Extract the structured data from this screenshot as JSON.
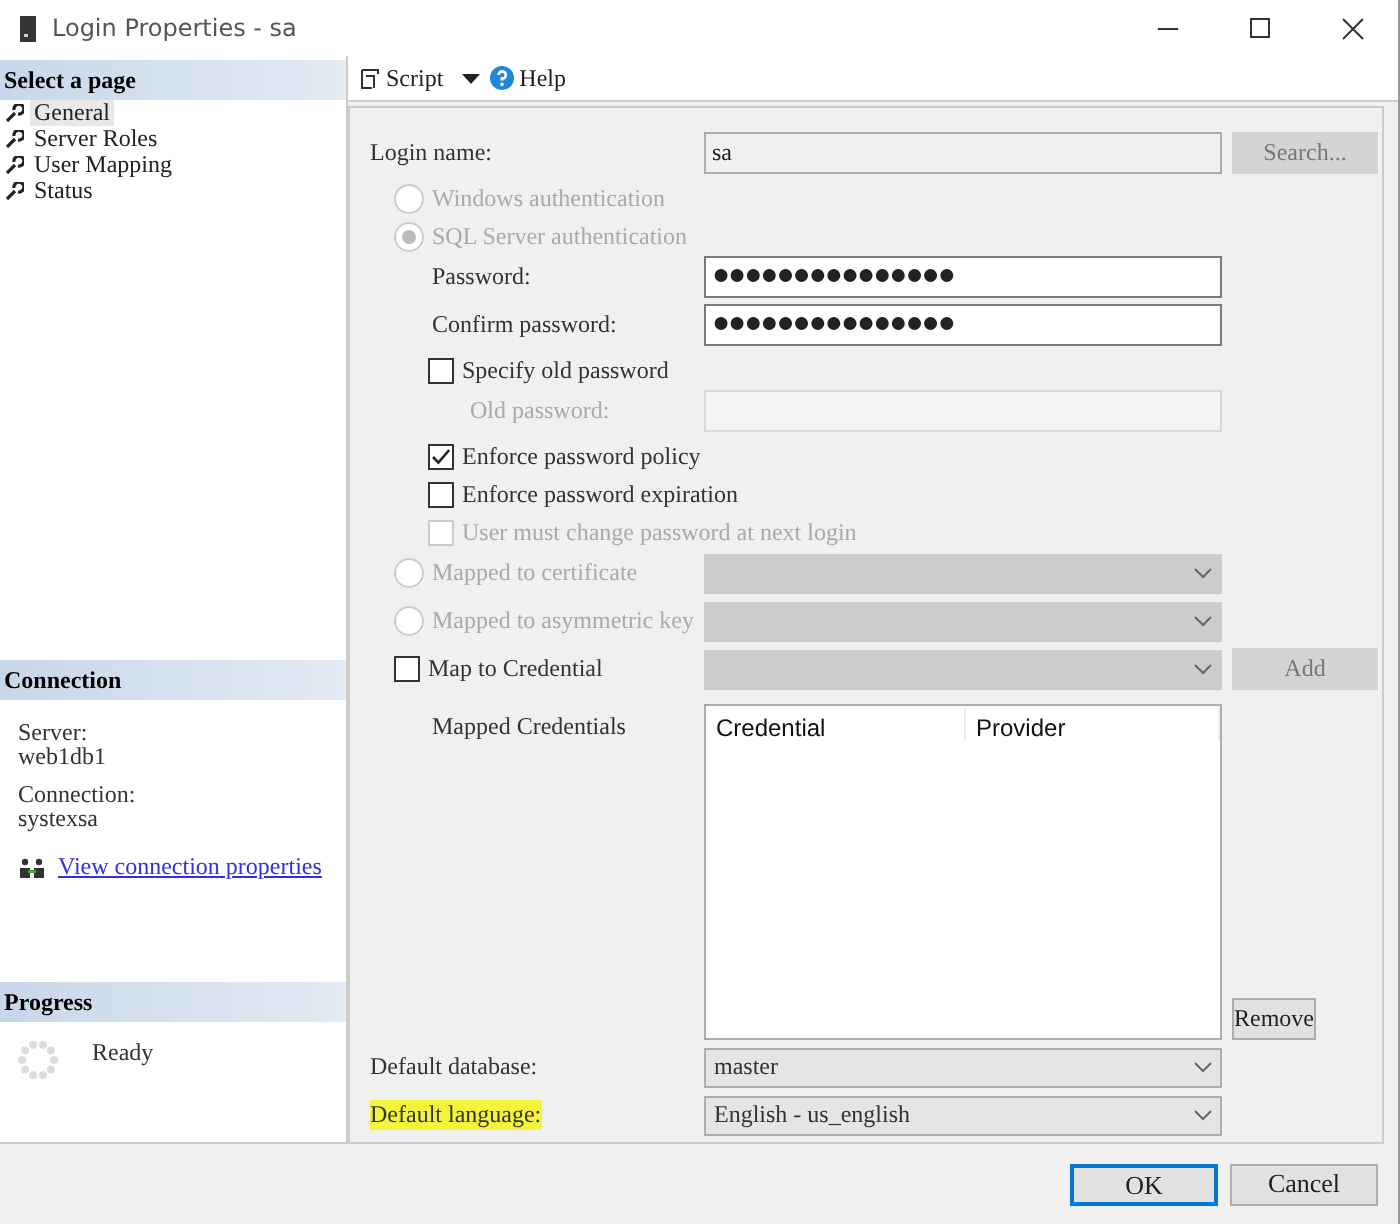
{
  "window": {
    "title": "Login Properties - sa"
  },
  "sidebar": {
    "header": "Select a page",
    "pages": [
      {
        "label": "General",
        "selected": true
      },
      {
        "label": "Server Roles",
        "selected": false
      },
      {
        "label": "User Mapping",
        "selected": false
      },
      {
        "label": "Status",
        "selected": false
      }
    ]
  },
  "connection": {
    "header": "Connection",
    "items": [
      {
        "label": "Server:",
        "value": "web1db1"
      },
      {
        "label": "Connection:",
        "value": "systexsa"
      }
    ],
    "link": "View connection properties"
  },
  "progress": {
    "header": "Progress",
    "status": "Ready"
  },
  "toolbar": {
    "script": "Script",
    "help": "Help"
  },
  "form": [
    {
      "kind": "field",
      "label": "Login name:",
      "disabled": false,
      "control": {
        "kind": "text",
        "value": "sa",
        "readonly": true,
        "disabled": false
      },
      "button": {
        "label": "Search...",
        "disabled": true
      }
    },
    {
      "kind": "radio",
      "label": "Windows authentication",
      "selected": false,
      "disabled": true
    },
    {
      "kind": "radio",
      "label": "SQL Server authentication",
      "selected": true,
      "disabled": true,
      "children": [
        {
          "kind": "field",
          "label": "Password:",
          "disabled": false,
          "control": {
            "kind": "password",
            "value": "●●●●●●●●●●●●●●●",
            "readonly": false,
            "disabled": false
          }
        },
        {
          "kind": "field",
          "label": "Confirm password:",
          "disabled": false,
          "control": {
            "kind": "password",
            "value": "●●●●●●●●●●●●●●●",
            "readonly": false,
            "disabled": false
          }
        },
        {
          "kind": "checkbox",
          "label": "Specify old password",
          "checked": false,
          "disabled": false,
          "children": [
            {
              "kind": "field",
              "label": "Old password:",
              "disabled": true,
              "control": {
                "kind": "text",
                "disabled": true
              }
            }
          ]
        },
        {
          "kind": "checkbox",
          "label": "Enforce password policy",
          "checked": true,
          "disabled": false
        },
        {
          "kind": "checkbox",
          "label": "Enforce password expiration",
          "checked": false,
          "disabled": false
        },
        {
          "kind": "checkbox",
          "label": "User must change password at next login",
          "checked": false,
          "disabled": true
        }
      ]
    },
    {
      "kind": "radio",
      "label": "Mapped to certificate",
      "selected": false,
      "disabled": true,
      "control": {
        "kind": "combo",
        "disabled": true
      }
    },
    {
      "kind": "radio",
      "label": "Mapped to asymmetric key",
      "selected": false,
      "disabled": true,
      "control": {
        "kind": "combo",
        "disabled": true
      }
    },
    {
      "kind": "checkbox",
      "label": "Map to Credential",
      "checked": false,
      "disabled": false,
      "control": {
        "kind": "combo",
        "disabled": true
      },
      "button": {
        "label": "Add",
        "disabled": true
      },
      "children": [
        {
          "kind": "list",
          "label": "Mapped Credentials",
          "columns": [
            "Credential",
            "Provider"
          ],
          "button": {
            "label": "Remove",
            "disabled": false
          }
        }
      ]
    },
    {
      "kind": "field",
      "label": "Default database:",
      "disabled": false,
      "highlighted": false,
      "control": {
        "kind": "combo",
        "value": "master",
        "disabled": false
      }
    },
    {
      "kind": "field",
      "label": "Default language:",
      "disabled": false,
      "highlighted": true,
      "control": {
        "kind": "combo",
        "value": "English - us_english",
        "disabled": false
      }
    }
  ],
  "buttons": [
    {
      "label": "OK",
      "focused": true
    },
    {
      "label": "Cancel",
      "focused": false
    }
  ]
}
